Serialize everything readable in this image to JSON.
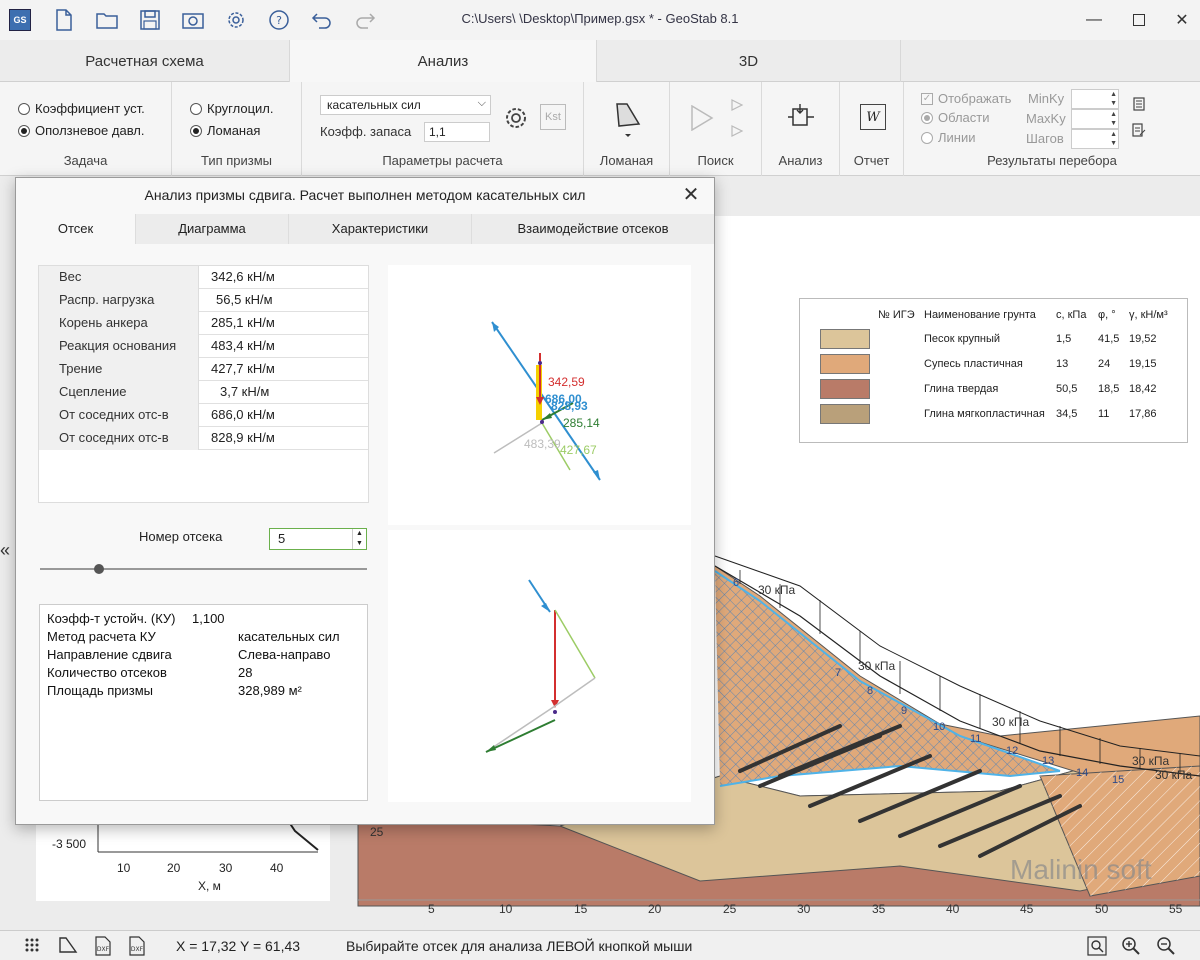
{
  "titlebar": {
    "app_icon_text": "GS",
    "title": "C:\\Users\\                \\Desktop\\Пример.gsx * - GeoStab 8.1",
    "icons": [
      "new-file-icon",
      "open-folder-icon",
      "save-icon",
      "camera-icon",
      "settings-gear-icon",
      "help-icon",
      "undo-icon",
      "redo-icon"
    ]
  },
  "ribbon_tabs": [
    {
      "label": "Расчетная схема"
    },
    {
      "label": "Анализ"
    },
    {
      "label": "3D"
    }
  ],
  "ribbon": {
    "task": {
      "label": "Задача",
      "options": [
        "Коэффициент уст.",
        "Оползневое давл."
      ],
      "selected": 1
    },
    "prism": {
      "label": "Тип призмы",
      "options": [
        "Круглоцил.",
        "Ломаная"
      ],
      "selected": 1
    },
    "params": {
      "label": "Параметры расчета",
      "method": "касательных сил",
      "safety_label": "Коэфф. запаса",
      "safety_value": "1,1",
      "kst_label": "Kst"
    },
    "polyline": {
      "label": "Ломаная"
    },
    "search": {
      "label": "Поиск"
    },
    "analysis": {
      "label": "Анализ"
    },
    "report": {
      "label": "Отчет",
      "icon_text": "W"
    },
    "results": {
      "label": "Результаты перебора",
      "show_label": "Отображать",
      "regions_label": "Области",
      "lines_label": "Линии",
      "minky_label": "MinKy",
      "maxky_label": "MaxKy",
      "steps_label": "Шагов"
    }
  },
  "dialog": {
    "title": "Анализ призмы сдвига. Расчет выполнен методом касательных сил",
    "tabs": [
      "Отсек",
      "Диаграмма",
      "Характеристики",
      "Взаимодействие отсеков"
    ],
    "params": [
      {
        "name": "Вес",
        "value": "342,6 кН/м"
      },
      {
        "name": "Распр. нагрузка",
        "value": "56,5 кН/м"
      },
      {
        "name": "Корень анкера",
        "value": "285,1 кН/м"
      },
      {
        "name": "Реакция основания",
        "value": "483,4 кН/м"
      },
      {
        "name": "Трение",
        "value": "427,7 кН/м"
      },
      {
        "name": "Сцепление",
        "value": "3,7 кН/м"
      },
      {
        "name": "От соседних отс-в",
        "value": "686,0 кН/м"
      },
      {
        "name": "От соседних отс-в",
        "value": "828,9 кН/м"
      }
    ],
    "segment_label": "Номер отсека",
    "segment_value": "5",
    "slider_fraction": 0.18,
    "summary": [
      {
        "name": "Коэфф-т устойч. (КУ)",
        "value": "1,100"
      },
      {
        "name": "Метод расчета КУ",
        "value": "касательных сил"
      },
      {
        "name": "Направление сдвига",
        "value": "Слева-направо"
      },
      {
        "name": "Количество отсеков",
        "value": "28"
      },
      {
        "name": "Площадь призмы",
        "value": "328,989 м²"
      }
    ],
    "force_labels": {
      "weight": "342,59",
      "left": "686,00",
      "right": "828,93",
      "anchor": "285,14",
      "reaction": "483,39",
      "friction": "427,67"
    },
    "colors": {
      "weight": "#d32f2f",
      "side": "#2f8fd0",
      "anchor": "#2e7d32",
      "friction": "#9ccc65",
      "reaction": "#bdbdbd",
      "load": "#f5d000"
    }
  },
  "legend": {
    "headers": [
      "№ ИГЭ",
      "Наименование грунта",
      "c, кПа",
      "φ, °",
      "γ, кН/м³"
    ],
    "rows": [
      {
        "name": "Песок крупный",
        "c": "1,5",
        "phi": "41,5",
        "gamma": "19,52",
        "color": "#dcc59a"
      },
      {
        "name": "Супесь пластичная",
        "c": "13",
        "phi": "24",
        "gamma": "19,15",
        "color": "#e0a97a"
      },
      {
        "name": "Глина твердая",
        "c": "50,5",
        "phi": "18,5",
        "gamma": "18,42",
        "color": "#b97b68"
      },
      {
        "name": "Глина мягкопластичная",
        "c": "34,5",
        "phi": "11",
        "gamma": "17,86",
        "color": "#b9a07a"
      }
    ]
  },
  "drawing": {
    "loads": [
      "30 кПа",
      "30 кПа",
      "30 кПа",
      "30 кПа",
      "30 кПа"
    ],
    "segment_numbers": [
      "6",
      "7",
      "8",
      "9",
      "10",
      "11",
      "12",
      "13",
      "14",
      "15"
    ],
    "x_ticks": [
      "5",
      "10",
      "15",
      "20",
      "25",
      "30",
      "35",
      "40",
      "45",
      "50",
      "55"
    ],
    "y_tick": "25",
    "watermark": "Malinin soft",
    "side_chart": {
      "y_tick": "-3 500",
      "x_ticks": [
        "10",
        "20",
        "30",
        "40"
      ],
      "xlabel": "X, м"
    }
  },
  "statusbar": {
    "coords": "X = 17,32  Y = 61,43",
    "hint": "Выбирайте отсек для анализа ЛЕВОЙ кнопкой мыши"
  }
}
